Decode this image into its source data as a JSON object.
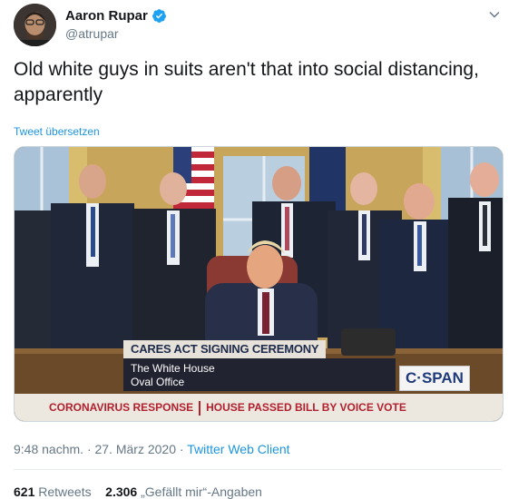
{
  "author": {
    "display_name": "Aaron Rupar",
    "handle": "@atrupar",
    "verified": true
  },
  "tweet": {
    "text": "Old white guys in suits aren't that into social distancing, apparently",
    "translate_link": "Tweet übersetzen"
  },
  "media": {
    "chyron_title": "CARES ACT SIGNING CEREMONY",
    "chyron_line1": "The White House",
    "chyron_line2": "Oval Office",
    "network_logo": "C·SPAN",
    "ticker_left": "CORONAVIRUS RESPONSE",
    "ticker_right": "HOUSE PASSED BILL BY VOICE VOTE"
  },
  "meta": {
    "timestamp": "9:48 nachm. · 27. März 2020",
    "separator": " · ",
    "client": "Twitter Web Client"
  },
  "stats": {
    "retweets_count": "621",
    "retweets_label": "Retweets",
    "likes_count": "2.306",
    "likes_label": "„Gefällt mir“-Angaben"
  },
  "colors": {
    "link": "#1b95e0",
    "secondary_text": "#657786",
    "primary_text": "#14171a",
    "verified_badge": "#1da1f2"
  }
}
